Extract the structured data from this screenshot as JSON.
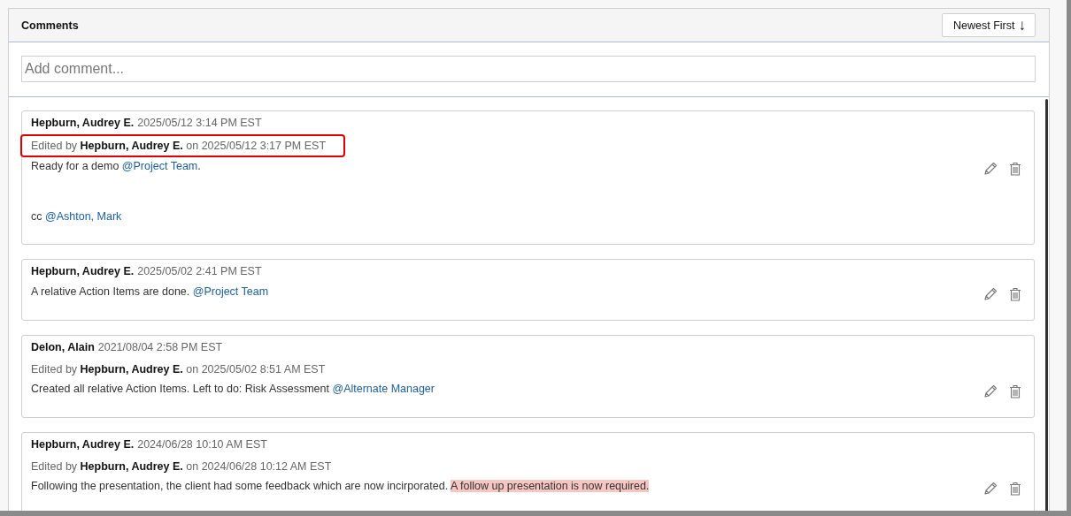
{
  "panel": {
    "title": "Comments",
    "sort_button": {
      "label": "Newest First",
      "arrow": "↓"
    }
  },
  "comment_field": {
    "placeholder": "Add comment..."
  },
  "comments": [
    {
      "author": "Hepburn, Audrey E.",
      "time": "2025/05/12 3:14 PM EST",
      "edit": {
        "text": "Edited by **Hepburn, Audrey E.** on 2025/05/12 3:17 PM EST",
        "annotated": true
      },
      "body": [
        [
          {
            "kind": "text",
            "text": "Ready for a demo "
          },
          {
            "kind": "mention",
            "text": "@Project Team"
          },
          {
            "kind": "text",
            "text": "."
          }
        ],
        [
          {
            "kind": "text",
            "text": "cc "
          },
          {
            "kind": "mention",
            "text": "@Ashton, Mark"
          }
        ]
      ]
    },
    {
      "author": "Hepburn, Audrey E.",
      "time": "2025/05/02 2:41 PM EST",
      "body": [
        [
          {
            "kind": "text",
            "text": "A relative Action Items are done. "
          },
          {
            "kind": "mention",
            "text": "@Project Team"
          }
        ]
      ]
    },
    {
      "author": "Delon, Alain",
      "time": "2021/08/04 2:58 PM EST",
      "edit": {
        "text": "Edited by **Hepburn, Audrey E.** on 2025/05/02 8:51 AM EST",
        "annotated": false
      },
      "body": [
        [
          {
            "kind": "text",
            "text": "Created all relative Action Items. Left to do: Risk Assessment "
          },
          {
            "kind": "mention",
            "text": "@Alternate Manager"
          }
        ]
      ]
    },
    {
      "author": "Hepburn, Audrey E.",
      "time": "2024/06/28 10:10 AM EST",
      "edit": {
        "text": "Edited by **Hepburn, Audrey E.** on 2024/06/28 10:12 AM EST",
        "annotated": false
      },
      "body": [
        [
          {
            "kind": "text",
            "text": "Following the presentation, the client had some feedback which are now incirporated. "
          },
          {
            "kind": "highlight",
            "text": "A follow up presentation is now required."
          }
        ]
      ]
    }
  ]
}
